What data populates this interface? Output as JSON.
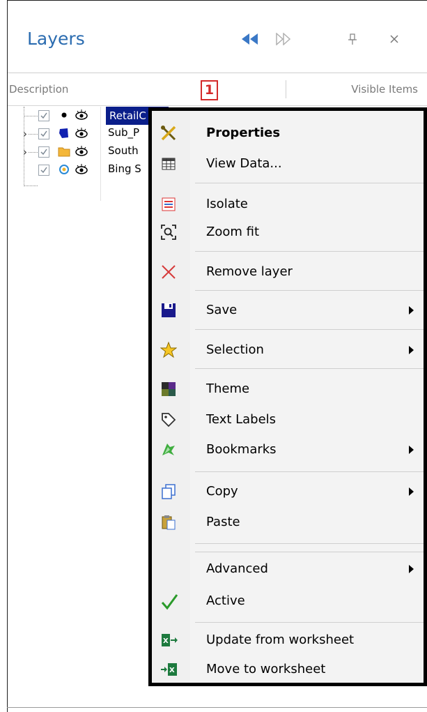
{
  "panel": {
    "title": "Layers",
    "buttons": [
      {
        "name": "collapse-left-button",
        "icon": "double-chevron-left-icon"
      },
      {
        "name": "expand-right-button",
        "icon": "double-chevron-right-icon"
      },
      {
        "name": "pin-button",
        "icon": "pin-icon"
      },
      {
        "name": "close-button",
        "icon": "close-icon"
      }
    ]
  },
  "columns": {
    "description": "Description",
    "visible_items": "Visible Items"
  },
  "callout": "1",
  "layers": [
    {
      "label": "RetailC",
      "icon": "point-layer-icon",
      "selected": true,
      "expandable": false
    },
    {
      "label": "Sub_P",
      "icon": "polygon-layer-icon",
      "selected": false,
      "expandable": true
    },
    {
      "label": "South",
      "icon": "folder-icon",
      "selected": false,
      "expandable": true
    },
    {
      "label": "Bing S",
      "icon": "bing-layer-icon",
      "selected": false,
      "expandable": false
    }
  ],
  "menu": {
    "items": [
      {
        "label": "Properties",
        "icon": "tools-icon",
        "bold": true,
        "submenu": false
      },
      {
        "label": "View Data...",
        "icon": "table-icon",
        "submenu": false
      },
      {
        "label": "Isolate",
        "icon": "isolate-icon",
        "submenu": false
      },
      {
        "label": "Zoom fit",
        "icon": "zoom-fit-icon",
        "submenu": false
      },
      {
        "label": "Remove layer",
        "icon": "remove-icon",
        "submenu": false
      },
      {
        "label": "Save",
        "icon": "save-icon",
        "submenu": true
      },
      {
        "label": "Selection",
        "icon": "star-icon",
        "submenu": true
      },
      {
        "label": "Theme",
        "icon": "theme-icon",
        "submenu": false
      },
      {
        "label": "Text Labels",
        "icon": "tag-icon",
        "submenu": false
      },
      {
        "label": "Bookmarks",
        "icon": "bookmark-icon",
        "submenu": true
      },
      {
        "label": "Copy",
        "icon": "copy-icon",
        "submenu": true
      },
      {
        "label": "Paste",
        "icon": "paste-icon",
        "submenu": false
      },
      {
        "label": "Advanced",
        "icon": "",
        "submenu": true
      },
      {
        "label": "Active",
        "icon": "checkmark-icon",
        "submenu": false
      },
      {
        "label": "Update from worksheet",
        "icon": "excel-import-icon",
        "submenu": false
      },
      {
        "label": "Move to worksheet",
        "icon": "excel-export-icon",
        "submenu": false
      }
    ]
  },
  "colors": {
    "title": "#2b6cb0",
    "selection": "#0a1e8a",
    "callout": "#d42a2a",
    "menu_border": "#000000"
  }
}
